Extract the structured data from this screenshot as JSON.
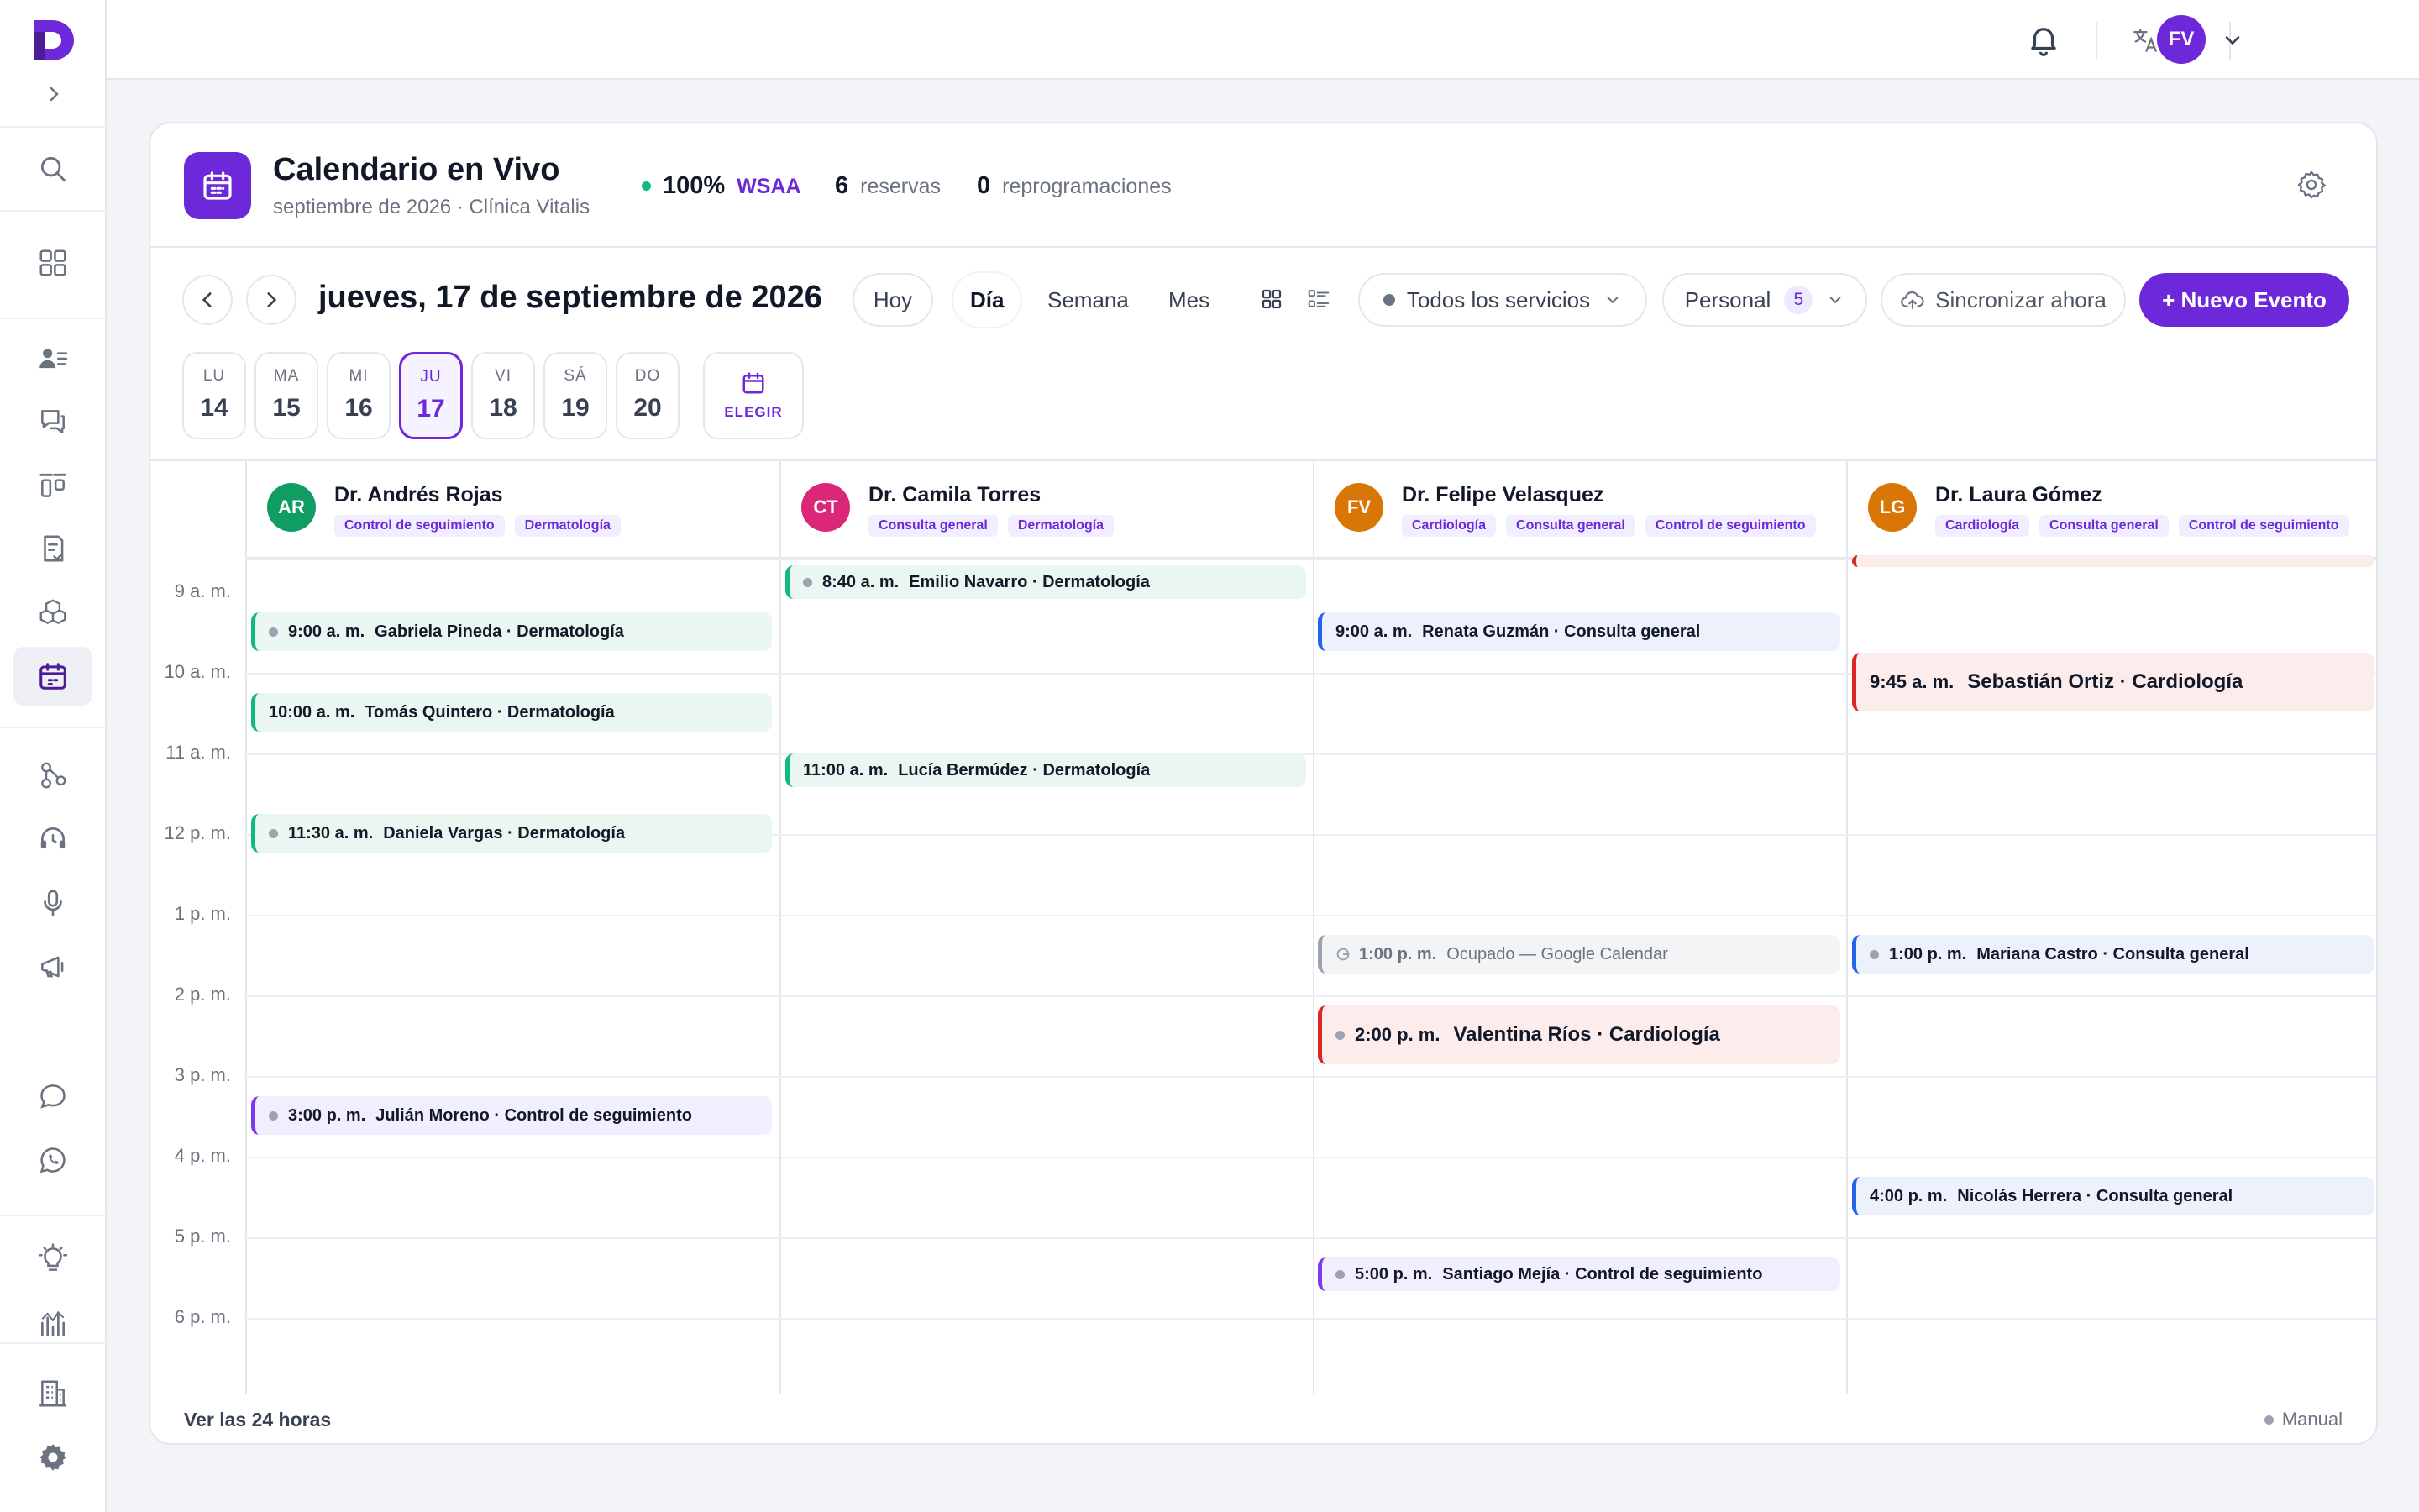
{
  "topbar": {
    "language": "ES",
    "user_initials": "FV"
  },
  "header": {
    "title": "Calendario en Vivo",
    "subtitle": "septiembre de 2026 · Clínica Vitalis",
    "stats": {
      "wsaa_value": "100%",
      "wsaa_label": "WSAA",
      "reservations_value": "6",
      "reservations_label": "reservas",
      "reschedules_value": "0",
      "reschedules_label": "reprogramaciones"
    }
  },
  "toolbar": {
    "date_title": "jueves, 17 de septiembre de 2026",
    "today": "Hoy",
    "views": {
      "day": "Día",
      "week": "Semana",
      "month": "Mes"
    },
    "services": "Todos los servicios",
    "staff": "Personal",
    "staff_count": "5",
    "sync": "Sincronizar ahora",
    "new_event": "+ Nuevo Evento"
  },
  "days": [
    {
      "name": "LU",
      "num": "14"
    },
    {
      "name": "MA",
      "num": "15"
    },
    {
      "name": "MI",
      "num": "16"
    },
    {
      "name": "JU",
      "num": "17"
    },
    {
      "name": "VI",
      "num": "18"
    },
    {
      "name": "SÁ",
      "num": "19"
    },
    {
      "name": "DO",
      "num": "20"
    }
  ],
  "pick_label": "ELEGIR",
  "hours": [
    "9 a. m.",
    "10 a. m.",
    "11 a. m.",
    "12 p. m.",
    "1 p. m.",
    "2 p. m.",
    "3 p. m.",
    "4 p. m.",
    "5 p. m.",
    "6 p. m."
  ],
  "doctors": [
    {
      "initials": "AR",
      "name": "Dr. Andrés Rojas",
      "tags": [
        "Control de seguimiento",
        "Dermatología"
      ],
      "color": "#0f9d63"
    },
    {
      "initials": "CT",
      "name": "Dr. Camila Torres",
      "tags": [
        "Consulta general",
        "Dermatología"
      ],
      "color": "#db2777"
    },
    {
      "initials": "FV",
      "name": "Dr. Felipe Velasquez",
      "tags": [
        "Cardiología",
        "Consulta general",
        "Control de seguimiento"
      ],
      "color": "#d97706"
    },
    {
      "initials": "LG",
      "name": "Dr. Laura Gómez",
      "tags": [
        "Cardiología",
        "Consulta general",
        "Control de seguimiento"
      ],
      "color": "#d97706"
    }
  ],
  "events": {
    "c0": [
      {
        "time": "9:00 a. m.",
        "desc": "Gabriela Pineda · Dermatología"
      },
      {
        "time": "10:00 a. m.",
        "desc": "Tomás Quintero · Dermatología"
      },
      {
        "time": "11:30 a. m.",
        "desc": "Daniela Vargas · Dermatología"
      },
      {
        "time": "3:00 p. m.",
        "desc": "Julián Moreno · Control de seguimiento"
      }
    ],
    "c1": [
      {
        "time": "8:40 a. m.",
        "desc": "Emilio Navarro · Dermatología"
      },
      {
        "time": "11:00 a. m.",
        "desc": "Lucía Bermúdez · Dermatología"
      }
    ],
    "c2": [
      {
        "time": "9:00 a. m.",
        "desc": "Renata Guzmán · Consulta general"
      },
      {
        "time": "1:00 p. m.",
        "desc": "Ocupado — Google Calendar"
      },
      {
        "time": "2:00 p. m.",
        "desc": "Valentina Ríos · Cardiología"
      },
      {
        "time": "5:00 p. m.",
        "desc": "Santiago Mejía · Control de seguimiento"
      }
    ],
    "c3": [
      {
        "time": "9:45 a. m.",
        "desc": "Sebastián Ortiz · Cardiología"
      },
      {
        "time": "1:00 p. m.",
        "desc": "Mariana Castro · Consulta general"
      },
      {
        "time": "4:00 p. m.",
        "desc": "Nicolás Herrera · Consulta general"
      }
    ]
  },
  "footer": {
    "show_all": "Ver las 24 horas",
    "mode": "Manual"
  },
  "colors": {
    "accent": "#6d28d9",
    "green": "#10b981",
    "blue": "#2563eb",
    "red": "#dc2626",
    "purple": "#7c3aed"
  }
}
